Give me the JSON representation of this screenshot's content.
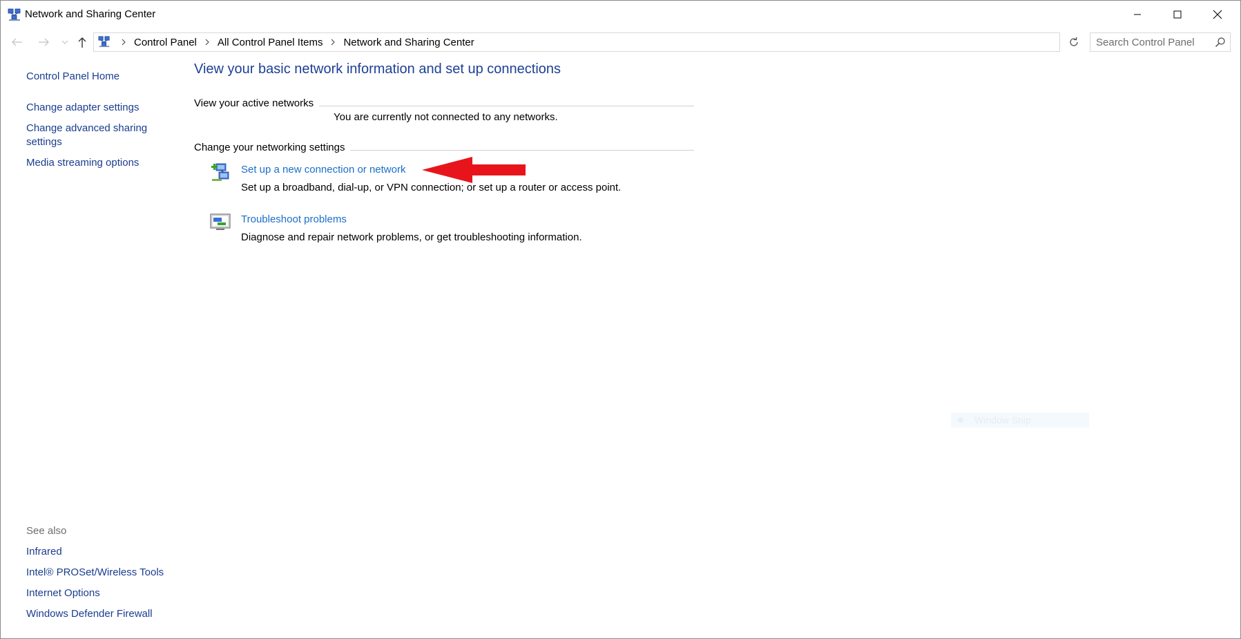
{
  "window": {
    "title": "Network and Sharing Center",
    "icon": "network-center-icon"
  },
  "window_controls": {
    "minimize": "minimize-icon",
    "maximize": "maximize-icon",
    "close": "close-icon"
  },
  "address_bar": {
    "breadcrumbs": [
      {
        "label": "Control Panel"
      },
      {
        "label": "All Control Panel Items"
      },
      {
        "label": "Network and Sharing Center"
      }
    ]
  },
  "search": {
    "placeholder": "Search Control Panel"
  },
  "left_pane": {
    "links": [
      {
        "label": "Control Panel Home"
      },
      {
        "label": "Change adapter settings"
      },
      {
        "label": "Change advanced sharing settings"
      },
      {
        "label": "Media streaming options"
      }
    ],
    "see_also": {
      "title": "See also",
      "links": [
        {
          "label": "Infrared"
        },
        {
          "label": "Intel® PROSet/Wireless Tools"
        },
        {
          "label": "Internet Options"
        },
        {
          "label": "Windows Defender Firewall"
        }
      ]
    }
  },
  "main": {
    "title": "View your basic network information and set up connections",
    "active_networks": {
      "heading": "View your active networks",
      "status": "You are currently not connected to any networks."
    },
    "networking_settings": {
      "heading": "Change your networking settings",
      "tasks": [
        {
          "link": "Set up a new connection or network",
          "description": "Set up a broadband, dial-up, or VPN connection; or set up a router or access point.",
          "icon": "new-connection-icon"
        },
        {
          "link": "Troubleshoot problems",
          "description": "Diagnose and repair network problems, or get troubleshooting information.",
          "icon": "troubleshoot-icon"
        }
      ]
    }
  },
  "overlay": {
    "snip_label": "Window Snip"
  },
  "colors": {
    "link": "#1a6fc9",
    "nav_link": "#1a3c8f",
    "title": "#1e3f95",
    "annotation_arrow": "#e8141c"
  }
}
